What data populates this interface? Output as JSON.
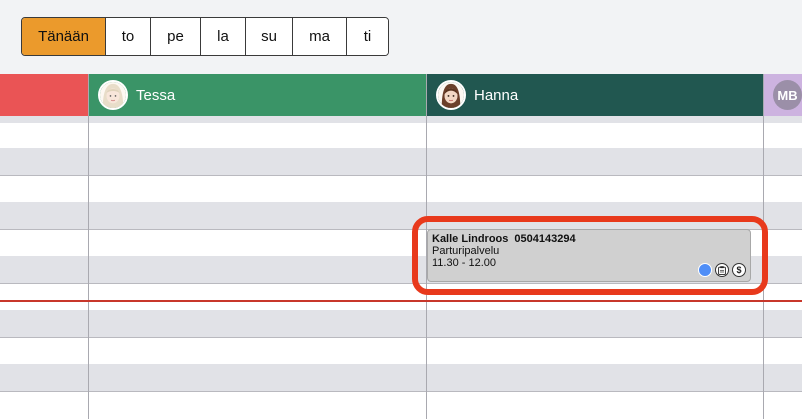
{
  "days": [
    {
      "label": "Tänään",
      "active": true
    },
    {
      "label": "to",
      "active": false
    },
    {
      "label": "pe",
      "active": false
    },
    {
      "label": "la",
      "active": false
    },
    {
      "label": "su",
      "active": false
    },
    {
      "label": "ma",
      "active": false
    },
    {
      "label": "ti",
      "active": false
    }
  ],
  "staff": [
    {
      "name": "",
      "color": "#ea5455"
    },
    {
      "name": "Tessa",
      "color": "#3a9467"
    },
    {
      "name": "Hanna",
      "color": "#215750"
    },
    {
      "initials": "MB",
      "color": "#cdb3e0"
    }
  ],
  "appointment": {
    "customer": "Kalle Lindroos",
    "phone": "0504143294",
    "service": "Parturipalvelu",
    "time": "11.30 - 12.00",
    "icon_note": "clipboard-icon",
    "icon_payment": "$"
  }
}
